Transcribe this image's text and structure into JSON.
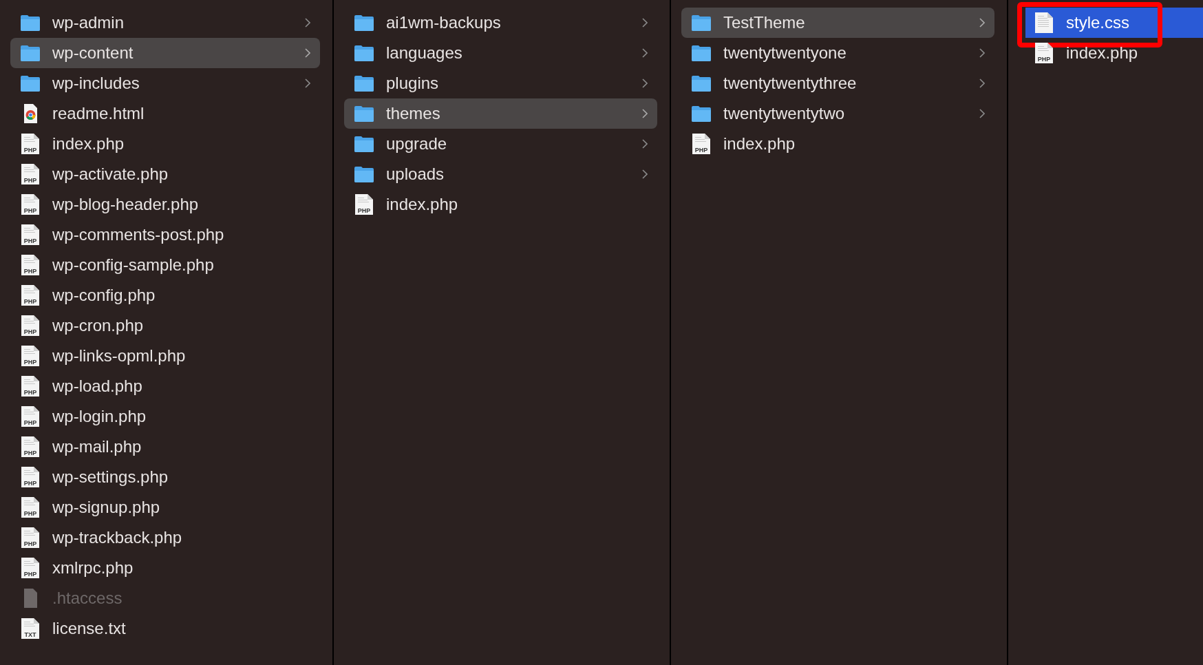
{
  "columns": [
    {
      "focused": false,
      "items": [
        {
          "kind": "folder",
          "name": "wp-admin",
          "selected": false
        },
        {
          "kind": "folder",
          "name": "wp-content",
          "selected": true
        },
        {
          "kind": "folder",
          "name": "wp-includes",
          "selected": false
        },
        {
          "kind": "browser",
          "name": "readme.html",
          "selected": false
        },
        {
          "kind": "document",
          "name": "index.php",
          "icon_label": "PHP",
          "selected": false
        },
        {
          "kind": "document",
          "name": "wp-activate.php",
          "icon_label": "PHP",
          "selected": false
        },
        {
          "kind": "document",
          "name": "wp-blog-header.php",
          "icon_label": "PHP",
          "selected": false
        },
        {
          "kind": "document",
          "name": "wp-comments-post.php",
          "icon_label": "PHP",
          "selected": false
        },
        {
          "kind": "document",
          "name": "wp-config-sample.php",
          "icon_label": "PHP",
          "selected": false
        },
        {
          "kind": "document",
          "name": "wp-config.php",
          "icon_label": "PHP",
          "selected": false
        },
        {
          "kind": "document",
          "name": "wp-cron.php",
          "icon_label": "PHP",
          "selected": false
        },
        {
          "kind": "document",
          "name": "wp-links-opml.php",
          "icon_label": "PHP",
          "selected": false
        },
        {
          "kind": "document",
          "name": "wp-load.php",
          "icon_label": "PHP",
          "selected": false
        },
        {
          "kind": "document",
          "name": "wp-login.php",
          "icon_label": "PHP",
          "selected": false
        },
        {
          "kind": "document",
          "name": "wp-mail.php",
          "icon_label": "PHP",
          "selected": false
        },
        {
          "kind": "document",
          "name": "wp-settings.php",
          "icon_label": "PHP",
          "selected": false
        },
        {
          "kind": "document",
          "name": "wp-signup.php",
          "icon_label": "PHP",
          "selected": false
        },
        {
          "kind": "document",
          "name": "wp-trackback.php",
          "icon_label": "PHP",
          "selected": false
        },
        {
          "kind": "document",
          "name": "xmlrpc.php",
          "icon_label": "PHP",
          "selected": false
        },
        {
          "kind": "blank",
          "name": ".htaccess",
          "selected": false,
          "hidden": true
        },
        {
          "kind": "document",
          "name": "license.txt",
          "icon_label": "TXT",
          "selected": false
        }
      ]
    },
    {
      "focused": false,
      "items": [
        {
          "kind": "folder",
          "name": "ai1wm-backups",
          "selected": false
        },
        {
          "kind": "folder",
          "name": "languages",
          "selected": false
        },
        {
          "kind": "folder",
          "name": "plugins",
          "selected": false
        },
        {
          "kind": "folder",
          "name": "themes",
          "selected": true
        },
        {
          "kind": "folder",
          "name": "upgrade",
          "selected": false
        },
        {
          "kind": "folder",
          "name": "uploads",
          "selected": false
        },
        {
          "kind": "document",
          "name": "index.php",
          "icon_label": "PHP",
          "selected": false
        }
      ]
    },
    {
      "focused": false,
      "items": [
        {
          "kind": "folder",
          "name": "TestTheme",
          "selected": true
        },
        {
          "kind": "folder",
          "name": "twentytwentyone",
          "selected": false
        },
        {
          "kind": "folder",
          "name": "twentytwentythree",
          "selected": false
        },
        {
          "kind": "folder",
          "name": "twentytwentytwo",
          "selected": false
        },
        {
          "kind": "document",
          "name": "index.php",
          "icon_label": "PHP",
          "selected": false
        }
      ]
    },
    {
      "focused": true,
      "items": [
        {
          "kind": "document",
          "name": "style.css",
          "selected": true,
          "highlighted": true
        },
        {
          "kind": "document",
          "name": "index.php",
          "icon_label": "PHP",
          "selected": false
        }
      ]
    }
  ]
}
